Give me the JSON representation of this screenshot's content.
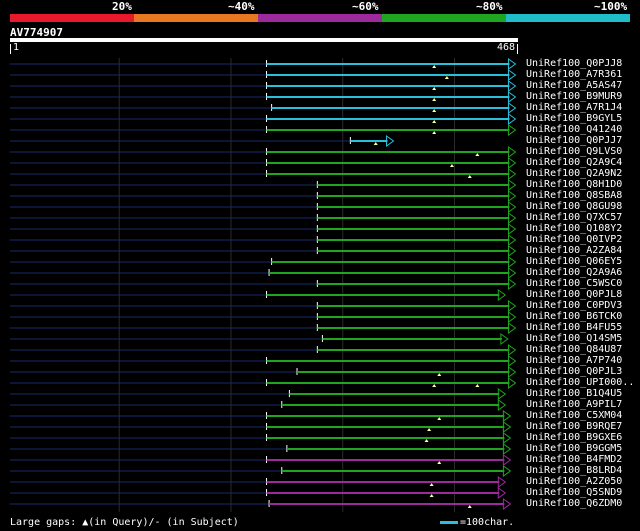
{
  "legend": {
    "labels": [
      "20%",
      "~40%",
      "~60%",
      "~80%",
      "~100%"
    ],
    "colors": [
      "#e8192c",
      "#e87722",
      "#9c2a9c",
      "#1fa51f",
      "#1fbcc9"
    ]
  },
  "query": {
    "name": "AV774907",
    "start": "1",
    "end": "468"
  },
  "hits": [
    {
      "name": "UniRef100_Q0PJJ8",
      "color": "#29c0dc",
      "start": 0.505,
      "end": 0.995,
      "marks": [
        0.835
      ]
    },
    {
      "name": "UniRef100_A7R361",
      "color": "#29c0dc",
      "start": 0.505,
      "end": 0.995,
      "marks": [
        0.86
      ]
    },
    {
      "name": "UniRef100_A5AS47",
      "color": "#29c0dc",
      "start": 0.505,
      "end": 0.995,
      "marks": [
        0.835
      ]
    },
    {
      "name": "UniRef100_B9MUR9",
      "color": "#29c0dc",
      "start": 0.505,
      "end": 0.995,
      "marks": [
        0.835
      ]
    },
    {
      "name": "UniRef100_A7R1J4",
      "color": "#29c0dc",
      "start": 0.515,
      "end": 0.995,
      "marks": [
        0.835
      ]
    },
    {
      "name": "UniRef100_B9GYL5",
      "color": "#29c0dc",
      "start": 0.505,
      "end": 0.995,
      "marks": [
        0.835
      ]
    },
    {
      "name": "UniRef100_Q41240",
      "color": "#1fa51f",
      "start": 0.505,
      "end": 0.995,
      "marks": [
        0.835
      ]
    },
    {
      "name": "UniRef100_Q0PJJ7",
      "color": "#29c0dc",
      "start": 0.67,
      "end": 0.755,
      "marks": [
        0.72
      ]
    },
    {
      "name": "UniRef100_Q9LVS0",
      "color": "#1fa51f",
      "start": 0.505,
      "end": 0.995,
      "marks": [
        0.92
      ]
    },
    {
      "name": "UniRef100_Q2A9C4",
      "color": "#1fa51f",
      "start": 0.505,
      "end": 0.995,
      "marks": [
        0.87
      ]
    },
    {
      "name": "UniRef100_Q2A9N2",
      "color": "#1fa51f",
      "start": 0.505,
      "end": 0.995,
      "marks": [
        0.905
      ]
    },
    {
      "name": "UniRef100_Q8H1D0",
      "color": "#1fa51f",
      "start": 0.605,
      "end": 0.995,
      "marks": []
    },
    {
      "name": "UniRef100_Q8SBA8",
      "color": "#1fa51f",
      "start": 0.605,
      "end": 0.995,
      "marks": []
    },
    {
      "name": "UniRef100_Q8GU98",
      "color": "#1fa51f",
      "start": 0.605,
      "end": 0.995,
      "marks": []
    },
    {
      "name": "UniRef100_Q7XC57",
      "color": "#1fa51f",
      "start": 0.605,
      "end": 0.995,
      "marks": []
    },
    {
      "name": "UniRef100_Q108Y2",
      "color": "#1fa51f",
      "start": 0.605,
      "end": 0.995,
      "marks": []
    },
    {
      "name": "UniRef100_Q0IVP2",
      "color": "#1fa51f",
      "start": 0.605,
      "end": 0.995,
      "marks": []
    },
    {
      "name": "UniRef100_A2ZA84",
      "color": "#1fa51f",
      "start": 0.605,
      "end": 0.995,
      "marks": []
    },
    {
      "name": "UniRef100_Q06EY5",
      "color": "#1fa51f",
      "start": 0.515,
      "end": 0.995,
      "marks": []
    },
    {
      "name": "UniRef100_Q2A9A6",
      "color": "#1fa51f",
      "start": 0.51,
      "end": 0.995,
      "marks": []
    },
    {
      "name": "UniRef100_C5WSC0",
      "color": "#1fa51f",
      "start": 0.605,
      "end": 0.995,
      "marks": []
    },
    {
      "name": "UniRef100_Q0PJL8",
      "color": "#1fa51f",
      "start": 0.505,
      "end": 0.975,
      "marks": []
    },
    {
      "name": "UniRef100_C0PDV3",
      "color": "#1fa51f",
      "start": 0.605,
      "end": 0.995,
      "marks": []
    },
    {
      "name": "UniRef100_B6TCK0",
      "color": "#1fa51f",
      "start": 0.605,
      "end": 0.995,
      "marks": []
    },
    {
      "name": "UniRef100_B4FU55",
      "color": "#1fa51f",
      "start": 0.605,
      "end": 0.995,
      "marks": []
    },
    {
      "name": "UniRef100_Q14SM5",
      "color": "#1fa51f",
      "start": 0.615,
      "end": 0.98,
      "marks": []
    },
    {
      "name": "UniRef100_Q84U87",
      "color": "#1fa51f",
      "start": 0.605,
      "end": 0.995,
      "marks": []
    },
    {
      "name": "UniRef100_A7P740",
      "color": "#1fa51f",
      "start": 0.505,
      "end": 0.995,
      "marks": []
    },
    {
      "name": "UniRef100_Q0PJL3",
      "color": "#1fa51f",
      "start": 0.565,
      "end": 0.995,
      "marks": [
        0.845
      ]
    },
    {
      "name": "UniRef100_UPI000..",
      "color": "#1fa51f",
      "start": 0.505,
      "end": 0.995,
      "marks": [
        0.835,
        0.92
      ]
    },
    {
      "name": "UniRef100_B1Q4U5",
      "color": "#1fa51f",
      "start": 0.55,
      "end": 0.975,
      "marks": []
    },
    {
      "name": "UniRef100_A9PIL7",
      "color": "#1fa51f",
      "start": 0.535,
      "end": 0.975,
      "marks": []
    },
    {
      "name": "UniRef100_C5XM04",
      "color": "#1fa51f",
      "start": 0.505,
      "end": 0.985,
      "marks": [
        0.845
      ]
    },
    {
      "name": "UniRef100_B9RQE7",
      "color": "#1fa51f",
      "start": 0.505,
      "end": 0.985,
      "marks": [
        0.825
      ]
    },
    {
      "name": "UniRef100_B9GXE6",
      "color": "#1fa51f",
      "start": 0.505,
      "end": 0.985,
      "marks": [
        0.82
      ]
    },
    {
      "name": "UniRef100_B9GGM5",
      "color": "#1fa51f",
      "start": 0.545,
      "end": 0.985,
      "marks": []
    },
    {
      "name": "UniRef100_B4FMD2",
      "color": "#9c2a9c",
      "start": 0.505,
      "end": 0.985,
      "marks": [
        0.845
      ]
    },
    {
      "name": "UniRef100_B8LRD4",
      "color": "#1fa51f",
      "start": 0.535,
      "end": 0.985,
      "marks": []
    },
    {
      "name": "UniRef100_A2Z050",
      "color": "#9c2a9c",
      "start": 0.505,
      "end": 0.975,
      "marks": [
        0.83
      ]
    },
    {
      "name": "UniRef100_Q5SND9",
      "color": "#9c2a9c",
      "start": 0.505,
      "end": 0.975,
      "marks": [
        0.83
      ]
    },
    {
      "name": "UniRef100_Q6ZDM0",
      "color": "#9c2a9c",
      "start": 0.51,
      "end": 0.985,
      "marks": [
        0.905
      ]
    }
  ],
  "footer": {
    "gaps_text": "Large gaps: ▲(in Query)/- (in Subject)",
    "scale_text": "=100char."
  }
}
